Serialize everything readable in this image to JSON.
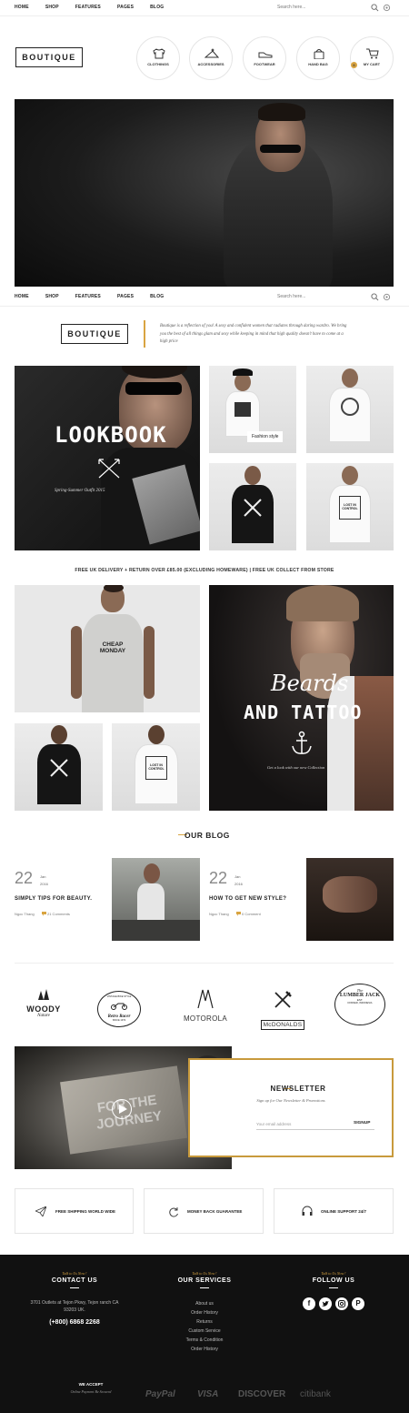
{
  "nav": {
    "items": [
      "HOME",
      "SHOP",
      "FEATURES",
      "PAGES",
      "BLOG"
    ],
    "search_placeholder": "Search here..."
  },
  "logo": "BOUTIQUE",
  "categories": [
    {
      "label": "CLOTHINGS",
      "icon": "tshirt-icon"
    },
    {
      "label": "ACCESSORIES",
      "icon": "hanger-icon"
    },
    {
      "label": "FOOTWEAR",
      "icon": "shoe-icon"
    },
    {
      "label": "HAND BAG",
      "icon": "bag-icon"
    },
    {
      "label": "MY CART",
      "icon": "cart-icon",
      "badge": "0"
    }
  ],
  "about": {
    "logo": "BOUTIQUE",
    "text": "Boutique is a reflection of you! A sexy and confident women that radiates through daring wardro. We bring you the best of all things glam and sexy while keeping in mind that high quality doesn't have to come at a high price"
  },
  "lookbook": {
    "title": "LOOKBOOK",
    "subtitle": "Spring-Summer Outfit 2015"
  },
  "fashion_label": "Fashion style",
  "shirt_prints": {
    "cheap_monday": "CHEAP MONDAY",
    "lost_in_control": "LOST IN CONTROL"
  },
  "promo_bar": "FREE UK DELIVERY + RETURN OVER £85.00 (EXCLUDING HOMEWARE) | FREE UK COLLECT FROM STORE",
  "beards": {
    "script": "Beards",
    "title": "AND TATTOO",
    "caption": "Get a look with our new Collection"
  },
  "blog": {
    "heading": "OUR BLOG",
    "posts": [
      {
        "day": "22",
        "month": "Jan",
        "year": "2016",
        "title": "SIMPLY TIPS FOR BEAUTY.",
        "author": "Ngoc Thang",
        "comments": "21 Comments"
      },
      {
        "day": "22",
        "month": "Jan",
        "year": "2016",
        "title": "HOW TO GET NEW STYLE?",
        "author": "Ngoc Thang",
        "comments": "0 Comment"
      }
    ]
  },
  "brands": {
    "woody": [
      "WOODY",
      "Nature"
    ],
    "retro": [
      "VINTAGE BIKE STYLE",
      "Retro Racer",
      "SINCE 1972"
    ],
    "motorola": "MOTOROLA",
    "mcdonalds": "McDONALDS",
    "lumberjack": [
      "The",
      "LUMBER JACK",
      "EST.",
      "DONNER, INDONESIA"
    ]
  },
  "video": {
    "text": "FOR THE JOURNEY"
  },
  "newsletter": {
    "heading": "NEWSLETTER",
    "sub": "Sign up for Our Newsletter & Promotions",
    "placeholder": "Your email address",
    "button": "SIGNUP"
  },
  "services": [
    {
      "label": "FREE SHIPPING WORLD WIDE",
      "icon": "paper-plane-icon"
    },
    {
      "label": "MONEY BACK GUARANTEE",
      "icon": "refresh-icon"
    },
    {
      "label": "ONLINE SUPPORT 24/7",
      "icon": "headset-icon"
    }
  ],
  "footer": {
    "talk": "Talk to Us Now !",
    "contact": {
      "head": "CONTACT US",
      "address": "3701 Outlets at Tejon Pkwy, Tejon ranch CA 93203 UK.",
      "phone": "(+800) 6868 2268"
    },
    "services": {
      "head": "OUR SERVICES",
      "items": [
        "About us",
        "Order History",
        "Returns",
        "Custom Service",
        "Terms & Condition",
        "Order History"
      ]
    },
    "follow": {
      "head": "FOLLOW US"
    },
    "accept": "WE ACCEPT",
    "accept_sub": "Online Payment Be Secured",
    "payments": [
      "PayPal",
      "VISA",
      "DISCOVER",
      "citibank"
    ]
  },
  "colors": {
    "accent": "#d9a441",
    "dark": "#111111"
  }
}
